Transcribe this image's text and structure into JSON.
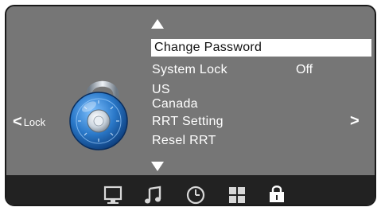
{
  "menu": {
    "items": [
      {
        "label": "Change Password",
        "value": ""
      },
      {
        "label": "System Lock",
        "value": "Off"
      },
      {
        "label": "US",
        "value": ""
      },
      {
        "label": "Canada",
        "value": ""
      },
      {
        "label": "RRT Setting",
        "value": ""
      },
      {
        "label": "Resel RRT",
        "value": ""
      }
    ],
    "selected_index": 0,
    "scroll_up_icon": "triangle-up-icon",
    "scroll_down_icon": "triangle-down-icon"
  },
  "nav": {
    "prev_symbol": "<",
    "prev_label": "Lock",
    "next_symbol": ">"
  },
  "bottom_bar": {
    "icons": [
      "monitor-icon",
      "music-note-icon",
      "clock-icon",
      "grid-icon",
      "padlock-icon"
    ],
    "active_icon": "padlock-icon"
  },
  "colors": {
    "background": "#767676",
    "bottom_bar": "#222222",
    "highlight": "#ffffff",
    "text": "#ffffff",
    "lock_blue": "#2f7fd0"
  }
}
